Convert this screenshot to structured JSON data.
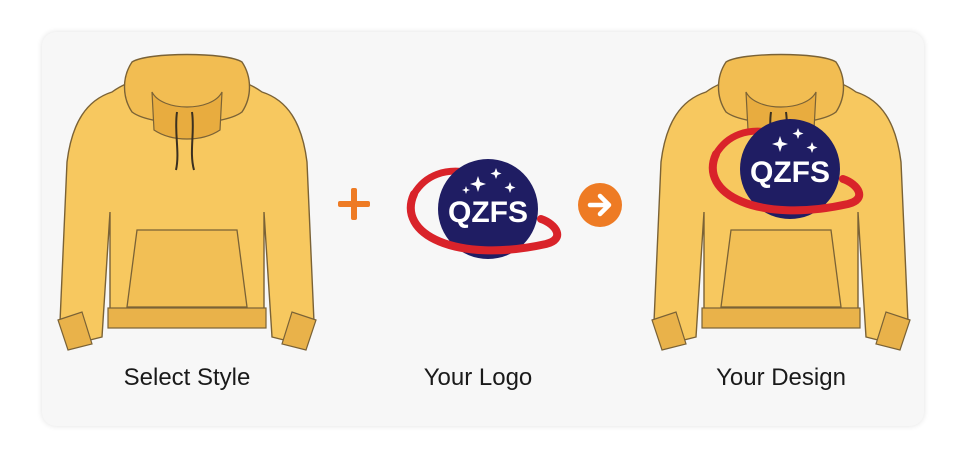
{
  "steps": [
    {
      "caption": "Select Style",
      "image": "yellow-hoodie"
    },
    {
      "caption": "Your Logo",
      "image": "qzfs-logo"
    },
    {
      "caption": "Your Design",
      "image": "yellow-hoodie-with-logo"
    }
  ],
  "logo": {
    "text": "QZFS"
  },
  "symbols": {
    "plus": "plus-icon",
    "arrow": "arrow-right-circle-icon"
  },
  "colors": {
    "hoodie": "#f7c85f",
    "hoodie_outline": "#7a6236",
    "cuff": "#e9b24a",
    "logo_navy": "#1f1d63",
    "logo_red": "#d9232a",
    "accent_orange": "#ee7b24",
    "card_bg": "#f7f7f7"
  }
}
